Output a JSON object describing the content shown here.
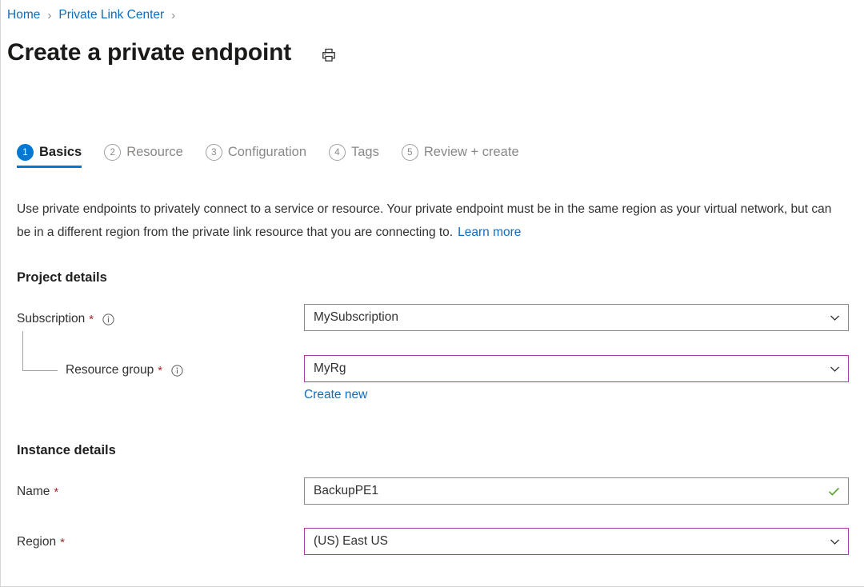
{
  "breadcrumb": {
    "items": [
      {
        "label": "Home"
      },
      {
        "label": "Private Link Center"
      }
    ],
    "separator": "›"
  },
  "header": {
    "title": "Create a private endpoint",
    "print_icon": "printer-icon"
  },
  "tabs": [
    {
      "num": "1",
      "label": "Basics",
      "active": true
    },
    {
      "num": "2",
      "label": "Resource",
      "active": false
    },
    {
      "num": "3",
      "label": "Configuration",
      "active": false
    },
    {
      "num": "4",
      "label": "Tags",
      "active": false
    },
    {
      "num": "5",
      "label": "Review + create",
      "active": false
    }
  ],
  "description": {
    "text": "Use private endpoints to privately connect to a service or resource. Your private endpoint must be in the same region as your virtual network, but can be in a different region from the private link resource that you are connecting to.",
    "link_label": "Learn more"
  },
  "project_details": {
    "heading": "Project details",
    "subscription": {
      "label": "Subscription",
      "required_marker": "*",
      "info_icon": "info-icon",
      "value": "MySubscription",
      "chevron_icon": "chevron-down-icon"
    },
    "resource_group": {
      "label": "Resource group",
      "required_marker": "*",
      "info_icon": "info-icon",
      "value": "MyRg",
      "chevron_icon": "chevron-down-icon",
      "create_new_label": "Create new"
    }
  },
  "instance_details": {
    "heading": "Instance details",
    "name": {
      "label": "Name",
      "required_marker": "*",
      "value": "BackupPE1",
      "validation_icon": "checkmark-icon"
    },
    "region": {
      "label": "Region",
      "required_marker": "*",
      "value": "(US) East US",
      "chevron_icon": "chevron-down-icon"
    }
  },
  "colors": {
    "accent_blue": "#0078d4",
    "link_blue": "#0f6cbd",
    "focus_purple": "#a93ea9",
    "required_red": "#a4262c",
    "valid_green": "#5ca52c",
    "border_grey": "#8a8886"
  }
}
